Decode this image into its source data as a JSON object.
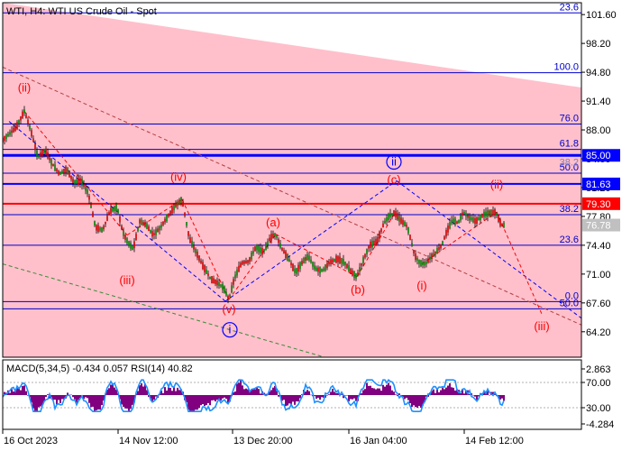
{
  "chart_data": [
    {
      "type": "line",
      "title": "WTI, H4:  WTI US Crude Oil - Spot",
      "xlabel": "",
      "ylabel": "",
      "ylim": [
        61.2,
        103.0
      ],
      "x_ticks": [
        "16 Oct 2023",
        "14 Nov 12:00",
        "13 Dec 20:00",
        "16 Jan 04:00",
        "14 Feb 12:00"
      ],
      "y_ticks": [
        101.6,
        98.2,
        94.8,
        91.4,
        88.0,
        84.6,
        81.2,
        77.8,
        74.4,
        71.0,
        67.6,
        64.2
      ],
      "y_tick_labels": [
        "101.60",
        "98.20",
        "94.80",
        "91.40",
        "88.00",
        "84.60",
        "81.20",
        "77.80",
        "74.40",
        "71.00",
        "67.60",
        "64.20"
      ],
      "price_tags": [
        {
          "label": "85.00",
          "value": 85.0,
          "color": "#0000ff"
        },
        {
          "label": "81.63",
          "value": 81.63,
          "color": "#0000ff"
        },
        {
          "label": "79.30",
          "value": 79.3,
          "color": "#ff0000"
        },
        {
          "label": "76.78",
          "value": 76.78,
          "color": "#c0c0c0"
        }
      ],
      "fib_levels": [
        {
          "label": "23.6",
          "value": 101.8
        },
        {
          "label": "100.0",
          "value": 94.75
        },
        {
          "label": "76.0",
          "value": 88.7
        },
        {
          "label": "61.8",
          "value": 85.7
        },
        {
          "label": "50.0",
          "value": 82.9
        },
        {
          "label": "38.2",
          "value": 78.0
        },
        {
          "label": "23.6",
          "value": 74.4
        },
        {
          "label": "0.0",
          "value": 67.75
        },
        {
          "label": "50.0",
          "value": 66.9
        }
      ],
      "faded_label": {
        "label": "38.2",
        "value": 83.7
      },
      "horizontal_lines": [
        {
          "value": 85.0,
          "color": "#0000ff",
          "width": 3
        },
        {
          "value": 81.63,
          "color": "#0000ff",
          "width": 2
        },
        {
          "value": 79.3,
          "color": "#ff0000",
          "width": 2
        }
      ],
      "wave_labels": [
        {
          "label": "(ii)",
          "x": 27,
          "y": 92.5,
          "color": "#ff0000"
        },
        {
          "label": "(iv)",
          "x": 198,
          "y": 82.0,
          "color": "#ff0000"
        },
        {
          "label": "(iii)",
          "x": 141,
          "y": 69.8,
          "color": "#ff0000"
        },
        {
          "label": "(v)",
          "x": 254,
          "y": 66.4,
          "color": "#ff0000"
        },
        {
          "label": "i",
          "x": 255,
          "y": 64.0,
          "color": "#0000ff",
          "circled": true
        },
        {
          "label": "(a)",
          "x": 303,
          "y": 76.6,
          "color": "#ff0000"
        },
        {
          "label": "(b)",
          "x": 397,
          "y": 68.7,
          "color": "#ff0000"
        },
        {
          "label": "ii",
          "x": 437,
          "y": 83.8,
          "color": "#0000ff",
          "circled": true
        },
        {
          "label": "(c)",
          "x": 437,
          "y": 81.7,
          "color": "#ff0000"
        },
        {
          "label": "(i)",
          "x": 468,
          "y": 69.2,
          "color": "#ff0000"
        },
        {
          "label": "(ii)",
          "x": 551,
          "y": 81.1,
          "color": "#ff0000"
        },
        {
          "label": "(iii)",
          "x": 601,
          "y": 64.4,
          "color": "#ff0000"
        }
      ],
      "price_path": [
        [
          3,
          86.8
        ],
        [
          10,
          87.5
        ],
        [
          18,
          88.3
        ],
        [
          27,
          90.2
        ],
        [
          34,
          88.0
        ],
        [
          42,
          84.8
        ],
        [
          50,
          85.6
        ],
        [
          58,
          84.0
        ],
        [
          66,
          82.8
        ],
        [
          74,
          83.4
        ],
        [
          82,
          81.8
        ],
        [
          90,
          82.0
        ],
        [
          98,
          80.5
        ],
        [
          106,
          76.5
        ],
        [
          114,
          76.2
        ],
        [
          122,
          78.4
        ],
        [
          130,
          78.9
        ],
        [
          136,
          76.0
        ],
        [
          142,
          74.7
        ],
        [
          148,
          74.0
        ],
        [
          155,
          77.2
        ],
        [
          162,
          76.8
        ],
        [
          170,
          75.6
        ],
        [
          178,
          76.5
        ],
        [
          186,
          77.8
        ],
        [
          194,
          79.0
        ],
        [
          202,
          79.8
        ],
        [
          210,
          75.2
        ],
        [
          218,
          73.5
        ],
        [
          226,
          71.8
        ],
        [
          234,
          70.4
        ],
        [
          242,
          69.9
        ],
        [
          248,
          69.4
        ],
        [
          254,
          68.0
        ],
        [
          260,
          70.5
        ],
        [
          268,
          72.3
        ],
        [
          276,
          72.5
        ],
        [
          284,
          74.2
        ],
        [
          292,
          73.6
        ],
        [
          300,
          75.3
        ],
        [
          306,
          75.7
        ],
        [
          312,
          74.1
        ],
        [
          320,
          72.8
        ],
        [
          328,
          71.2
        ],
        [
          336,
          72.5
        ],
        [
          342,
          73.1
        ],
        [
          350,
          71.6
        ],
        [
          358,
          71.4
        ],
        [
          366,
          72.4
        ],
        [
          374,
          72.8
        ],
        [
          382,
          72.4
        ],
        [
          390,
          71.2
        ],
        [
          396,
          70.7
        ],
        [
          402,
          72.4
        ],
        [
          410,
          74.4
        ],
        [
          418,
          74.8
        ],
        [
          426,
          77.0
        ],
        [
          432,
          77.9
        ],
        [
          438,
          78.2
        ],
        [
          444,
          77.4
        ],
        [
          452,
          76.6
        ],
        [
          460,
          73.2
        ],
        [
          466,
          72.3
        ],
        [
          472,
          72.2
        ],
        [
          478,
          73.0
        ],
        [
          484,
          73.6
        ],
        [
          490,
          74.4
        ],
        [
          496,
          76.1
        ],
        [
          502,
          77.4
        ],
        [
          508,
          77.0
        ],
        [
          514,
          78.3
        ],
        [
          520,
          77.7
        ],
        [
          528,
          77.2
        ],
        [
          536,
          78.0
        ],
        [
          544,
          78.2
        ],
        [
          550,
          78.3
        ],
        [
          556,
          76.8
        ],
        [
          560,
          76.8
        ]
      ],
      "pink_boundary": [
        [
          3,
          103.0
        ],
        [
          645,
          93.0
        ]
      ],
      "trend_lines": [
        {
          "points": [
            [
              3,
              95.4
            ],
            [
              645,
              65.0
            ]
          ],
          "style": "dashed",
          "color": "#b04040"
        },
        {
          "points": [
            [
              3,
              72.2
            ],
            [
              360,
              61.2
            ]
          ],
          "style": "dashed",
          "color": "#3b8a3b"
        },
        {
          "points": [
            [
              10,
              89.0
            ],
            [
              250,
              67.8
            ]
          ],
          "style": "dashed",
          "color": "#0000ff"
        },
        {
          "points": [
            [
              250,
              67.8
            ],
            [
              440,
              82.0
            ]
          ],
          "style": "dashed",
          "color": "#0000ff"
        },
        {
          "points": [
            [
              440,
              82.0
            ],
            [
              645,
              65.8
            ]
          ],
          "style": "dashed",
          "color": "#0000ff"
        },
        {
          "points": [
            [
              27,
              90.2
            ],
            [
              141,
              75.6
            ]
          ],
          "style": "dashed",
          "color": "#ff0000"
        },
        {
          "points": [
            [
              141,
              75.6
            ],
            [
              202,
              79.8
            ]
          ],
          "style": "dashed",
          "color": "#ff0000"
        },
        {
          "points": [
            [
              202,
              79.8
            ],
            [
              254,
              68.0
            ]
          ],
          "style": "dashed",
          "color": "#ff0000"
        },
        {
          "points": [
            [
              254,
              68.0
            ],
            [
              306,
              75.7
            ]
          ],
          "style": "dashed",
          "color": "#ff0000"
        },
        {
          "points": [
            [
              306,
              75.7
            ],
            [
              396,
              70.7
            ]
          ],
          "style": "dashed",
          "color": "#ff0000"
        },
        {
          "points": [
            [
              396,
              70.7
            ],
            [
              438,
              78.2
            ]
          ],
          "style": "dashed",
          "color": "#ff0000"
        },
        {
          "points": [
            [
              468,
              72.2
            ],
            [
              551,
              78.3
            ]
          ],
          "style": "dashed",
          "color": "#ff0000"
        },
        {
          "points": [
            [
              551,
              78.3
            ],
            [
              601,
              66.3
            ]
          ],
          "style": "dashed",
          "color": "#ff0000"
        }
      ]
    },
    {
      "type": "bar",
      "title": "MACD(5,34,5) -0.434 0.057 RSI(14) 40.82",
      "y_tick_labels": [
        "2.863",
        "70.00",
        "30.00",
        "-4.284"
      ],
      "y_tick_values": [
        2.863,
        70.0,
        30.0,
        -4.284
      ],
      "histogram_color": "#800080",
      "rsi_color": "#1e90ff"
    }
  ]
}
